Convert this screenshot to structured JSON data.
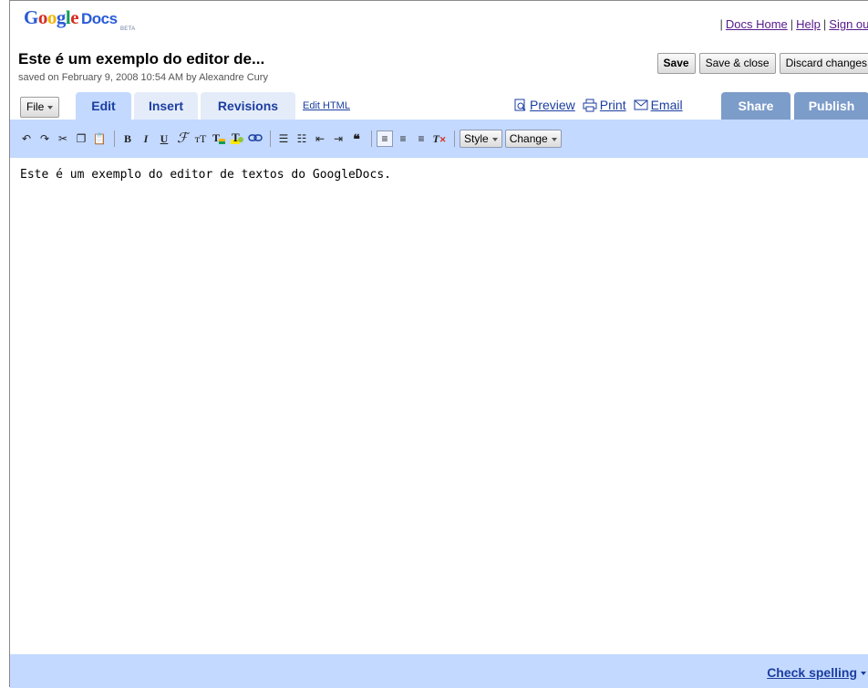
{
  "app": {
    "logo": {
      "g1": "G",
      "o1": "o",
      "o2": "o",
      "g2": "g",
      "l": "l",
      "e": "e",
      "docs": "Docs",
      "beta": "BETA"
    },
    "toplinks": {
      "sep_first": "|",
      "docs_home": "Docs Home",
      "sep1": "|",
      "help": "Help",
      "sep2": "|",
      "sign_out": "Sign out"
    }
  },
  "document": {
    "title": "Este é um exemplo do editor de...",
    "saved_line": "saved on February 9, 2008 10:54 AM by Alexandre Cury",
    "body_text": "Este é um exemplo do editor de textos do GoogleDocs."
  },
  "actions": {
    "save": "Save",
    "save_close": "Save & close",
    "discard": "Discard changes"
  },
  "tabs": {
    "file": "File",
    "edit": "Edit",
    "insert": "Insert",
    "revisions": "Revisions",
    "edit_html": "Edit HTML",
    "preview": "Preview",
    "print": "Print",
    "email": "Email",
    "share": "Share",
    "publish": "Publish"
  },
  "toolbar": {
    "style": "Style",
    "change": "Change"
  },
  "footer": {
    "check_spelling": "Check spelling"
  },
  "colors": {
    "accent": "#c3d9ff",
    "tab_inactive": "#e5ecf9",
    "share_tab": "#7c9cc9",
    "link": "#1c3ea0"
  }
}
